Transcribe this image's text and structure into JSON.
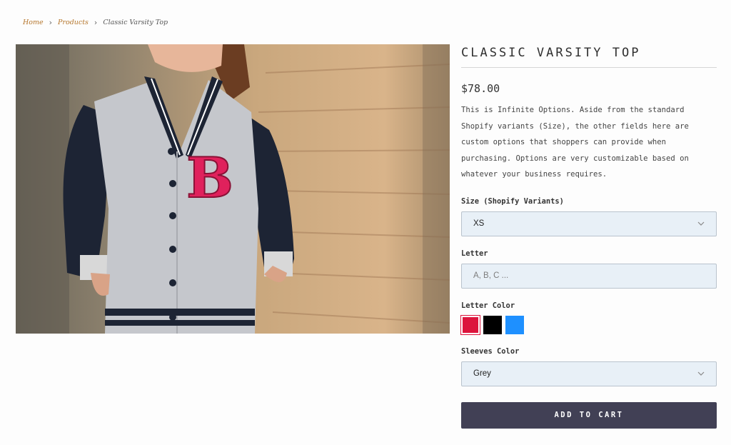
{
  "breadcrumb": {
    "home": "Home",
    "products": "Products",
    "current": "Classic Varsity Top",
    "separator": "›"
  },
  "product": {
    "title": "CLASSIC VARSITY TOP",
    "price": "$78.00",
    "description": "This is Infinite Options. Aside from the standard Shopify variants (Size), the other fields here are custom options that shoppers can provide when purchasing. Options are very customizable based on whatever your business requires.",
    "image_alt": "Woman wearing grey varsity jacket with pink letter B",
    "image_letter": "B"
  },
  "size": {
    "label": "Size (Shopify Variants)",
    "value": "XS"
  },
  "letter": {
    "label": "Letter",
    "placeholder": "A, B, C ..."
  },
  "letter_color": {
    "label": "Letter Color",
    "swatches": [
      {
        "name": "red",
        "color": "#dc143c",
        "selected": true
      },
      {
        "name": "black",
        "color": "#000000",
        "selected": false
      },
      {
        "name": "blue",
        "color": "#1e90ff",
        "selected": false
      }
    ]
  },
  "sleeves_color": {
    "label": "Sleeves Color",
    "value": "Grey"
  },
  "cart": {
    "label": "ADD TO CART"
  },
  "colors": {
    "accent_link": "#b5762c",
    "button_bg": "#414055",
    "input_bg": "#e8f0f7"
  }
}
